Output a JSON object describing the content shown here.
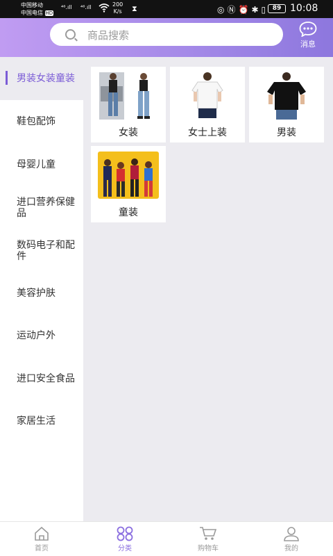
{
  "status_bar": {
    "carrier1": "中国移动",
    "carrier2": "中国电信",
    "hd": "HD",
    "signal1": "⁴⁶.ıll",
    "signal2": "⁴⁶.ıll",
    "speed_value": "200",
    "speed_unit": "K/s",
    "battery": "89",
    "time": "10:08"
  },
  "header": {
    "search_placeholder": "商品搜索",
    "message_label": "消息"
  },
  "sidebar": {
    "items": [
      {
        "label": "男装女装童装",
        "active": true
      },
      {
        "label": "鞋包配饰"
      },
      {
        "label": "母婴儿童"
      },
      {
        "label": "进口营养保健品"
      },
      {
        "label": "数码电子和配件"
      },
      {
        "label": "美容护肤"
      },
      {
        "label": "运动户外"
      },
      {
        "label": "进口安全食品"
      },
      {
        "label": "家居生活"
      }
    ]
  },
  "categories": [
    {
      "label": "女装",
      "icon": "women-clothing-image"
    },
    {
      "label": "女士上装",
      "icon": "women-tops-image"
    },
    {
      "label": "男装",
      "icon": "men-clothing-image"
    },
    {
      "label": "童装",
      "icon": "kids-clothing-image"
    }
  ],
  "tabbar": {
    "items": [
      {
        "label": "首页"
      },
      {
        "label": "分类",
        "active": true
      },
      {
        "label": "购物车"
      },
      {
        "label": "我的"
      }
    ]
  },
  "colors": {
    "accent": "#8b6fe0",
    "header_start": "#c09cf2",
    "header_end": "#8d77de"
  }
}
